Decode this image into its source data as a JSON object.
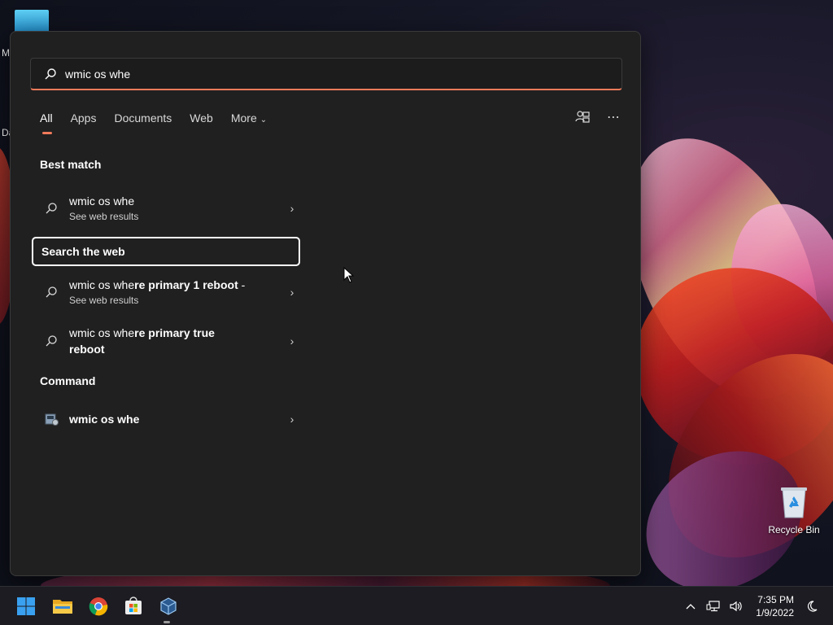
{
  "desktop": {
    "left_labels": [
      "M",
      "Da"
    ],
    "recycle_bin_label": "Recycle Bin"
  },
  "search": {
    "query": "wmic os whe",
    "icon": "search-icon"
  },
  "tabs": [
    {
      "label": "All",
      "active": true
    },
    {
      "label": "Apps"
    },
    {
      "label": "Documents"
    },
    {
      "label": "Web"
    },
    {
      "label": "More",
      "icon": "chevron-down-icon"
    }
  ],
  "top_icons": [
    "account-switch-icon",
    "more-options-icon"
  ],
  "best_match": {
    "title": "Best match",
    "item": {
      "main": "wmic os whe",
      "sub": "See web results"
    }
  },
  "search_web": {
    "title": "Search the web",
    "items": [
      {
        "prefix": "wmic os whe",
        "bold": "re primary 1 reboot",
        "suffix": " -",
        "sub": "See web results"
      },
      {
        "prefix": "wmic os whe",
        "bold": "re primary true",
        "line2": "reboot"
      }
    ]
  },
  "command": {
    "title": "Command",
    "item": {
      "main": "wmic os whe"
    }
  },
  "taskbar": {
    "apps": [
      "windows-start-icon",
      "file-explorer-icon",
      "chrome-icon",
      "store-icon",
      "virtualbox-icon"
    ],
    "tray": [
      "chevron-up-icon",
      "network-icon",
      "volume-icon"
    ],
    "time": "7:35 PM",
    "date": "1/9/2022",
    "focus_icon": "focus-assist-icon"
  },
  "colors": {
    "accent": "#f07a5a",
    "panel_bg": "#202020"
  }
}
